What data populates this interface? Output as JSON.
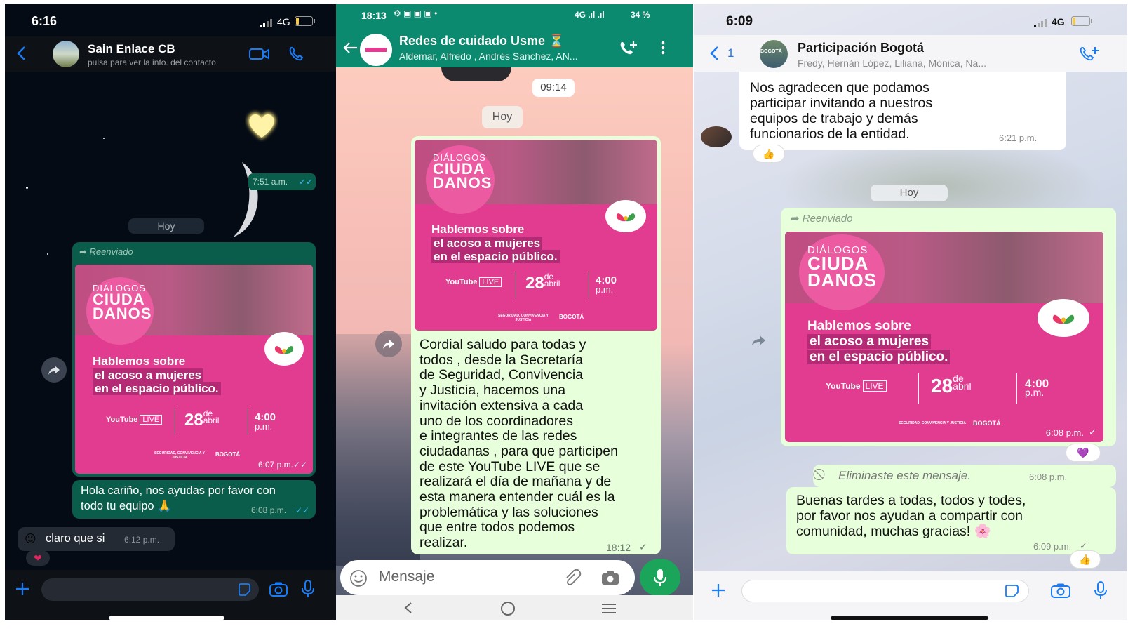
{
  "panel1": {
    "status_time": "6:16",
    "network": "4G",
    "contact_name": "Sain Enlace CB",
    "contact_subtitle": "pulsa para ver la info. del contacto",
    "msg_heart_time": "7:51 a.m.",
    "day_label": "Hoy",
    "forwarded_label": "Reenviado",
    "poster_time": "6:07 p.m.",
    "msg_out_text_line1": "Hola cariño, nos ayudas por favor con",
    "msg_out_text_line2": "todo tu equipo",
    "msg_out_emoji": "🙏",
    "msg_out_time": "6:08 p.m.",
    "msg_in_emoji": "😉",
    "msg_in_text": "claro que si",
    "msg_in_time": "6:12 p.m.",
    "reaction": "❤"
  },
  "panel2": {
    "status_time": "18:13",
    "network": "4G",
    "battery": "34 %",
    "group_name": "Redes de cuidado Usme",
    "group_emoji": "⏳",
    "group_members": "Aldemar, Alfredo , Andrés Sanchez, AN...",
    "date_chip": "09:14",
    "day_label": "Hoy",
    "message_lines": [
      "Cordial saludo para todas y",
      "todos , desde la Secretaría",
      "de Seguridad, Convivencia",
      "y Justicia, hacemos una",
      "invitación extensiva a cada",
      "uno de los coordinadores",
      "e integrantes de las redes",
      "ciudadanas , para que participen",
      "de este YouTube LIVE que se",
      "realizará el día de mañana y de",
      "esta manera entender cuál es la",
      "problemática y las soluciones",
      "que entre todos podemos",
      "realizar."
    ],
    "message_time": "18:12",
    "input_placeholder": "Mensaje"
  },
  "panel3": {
    "status_time": "6:09",
    "network": "4G",
    "back_count": "1",
    "avatar_text": "BOGOTÁ",
    "group_name": "Participación Bogotá",
    "group_members": "Fredy, Hernán López, Liliana, Mónica, Na...",
    "msg1_lines": [
      "Nos agradecen que podamos",
      "participar invitando a nuestros",
      "equipos de trabajo y demás",
      "funcionarios de la entidad."
    ],
    "msg1_time": "6:21 p.m.",
    "msg1_reaction": "👍",
    "day_label": "Hoy",
    "forwarded_label": "Reenviado",
    "poster_time": "6:08 p.m.",
    "poster_reaction": "💜",
    "deleted_text": "Eliminaste este mensaje.",
    "deleted_time": "6:08 p.m.",
    "msg2_lines": [
      "Buenas tardes a todas, todos y todes,",
      "por favor nos ayudan a compartir con",
      "comunidad, muchas gracias!"
    ],
    "msg2_emoji": "🌸",
    "msg2_time": "6:09 p.m.",
    "msg2_reaction": "👍"
  },
  "poster": {
    "dialogos": "DIÁLOGOS",
    "ciuda": "CIUDA",
    "danos": "DANOS",
    "headline_1": "Hablemos sobre",
    "headline_2": "el acoso a mujeres",
    "headline_3": "en el espacio público.",
    "youtube": "YouTube",
    "live": "LIVE",
    "day": "28",
    "de": "de",
    "month": "abril",
    "hour": "4:00",
    "ampm": "p.m.",
    "footer_entity": "SEGURIDAD, CONVIVENCIA Y JUSTICIA",
    "footer_city": "BOGOTÁ"
  },
  "colors": {
    "dark_bg": "#050b14",
    "wa_dark_out": "#0b5d4b",
    "wa_green": "#0b8a6f",
    "light_out": "#dcf8c6",
    "poster_pink": "#e13c8f",
    "ios_blue": "#1a7cf5"
  }
}
